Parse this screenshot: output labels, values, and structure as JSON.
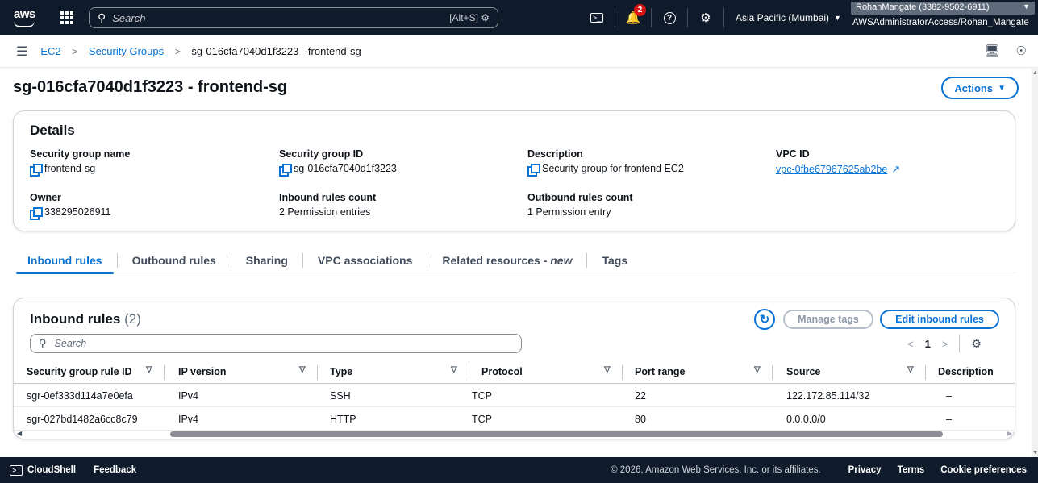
{
  "topnav": {
    "logo_text": "aws",
    "search_placeholder": "Search",
    "search_shortcut": "[Alt+S]",
    "notification_count": "2",
    "region": "Asia Pacific (Mumbai)",
    "account_name": "RohanMangate (3382-9502-6911)",
    "account_role": "AWSAdministratorAccess/Rohan_Mangate"
  },
  "breadcrumb": {
    "items": [
      "EC2",
      "Security Groups"
    ],
    "current": "sg-016cfa7040d1f3223 - frontend-sg"
  },
  "page": {
    "title": "sg-016cfa7040d1f3223 - frontend-sg",
    "actions_label": "Actions"
  },
  "details": {
    "heading": "Details",
    "fields": [
      {
        "label": "Security group name",
        "value": "frontend-sg"
      },
      {
        "label": "Security group ID",
        "value": "sg-016cfa7040d1f3223"
      },
      {
        "label": "Description",
        "value": "Security group for frontend EC2"
      },
      {
        "label": "VPC ID",
        "value": "vpc-0fbe67967625ab2be"
      },
      {
        "label": "Owner",
        "value": "338295026911"
      },
      {
        "label": "Inbound rules count",
        "value": "2 Permission entries"
      },
      {
        "label": "Outbound rules count",
        "value": "1 Permission entry"
      }
    ]
  },
  "tabs": {
    "inbound": "Inbound rules",
    "outbound": "Outbound rules",
    "sharing": "Sharing",
    "vpc": "VPC associations",
    "related": "Related resources - ",
    "related_new": "new",
    "tags": "Tags"
  },
  "rules": {
    "heading": "Inbound rules",
    "count": "(2)",
    "manage_tags": "Manage tags",
    "edit_rules": "Edit inbound rules",
    "search_placeholder": "Search",
    "page": "1",
    "columns": [
      "Security group rule ID",
      "IP version",
      "Type",
      "Protocol",
      "Port range",
      "Source",
      "Description"
    ],
    "rows": [
      [
        "sgr-0ef333d114a7e0efa",
        "IPv4",
        "SSH",
        "TCP",
        "22",
        "122.172.85.114/32",
        "–"
      ],
      [
        "sgr-027bd1482a6cc8c79",
        "IPv4",
        "HTTP",
        "TCP",
        "80",
        "0.0.0.0/0",
        "–"
      ]
    ]
  },
  "footer": {
    "cloudshell": "CloudShell",
    "feedback": "Feedback",
    "copyright": "© 2026, Amazon Web Services, Inc. or its affiliates.",
    "privacy": "Privacy",
    "terms": "Terms",
    "cookies": "Cookie preferences"
  },
  "colors": {
    "nav_bg": "#0f1b2a",
    "link_blue": "#0972d3",
    "badge_red": "#d91515"
  },
  "icons": {
    "search": "search-icon",
    "grid": "services-grid-icon",
    "cloudshell": "cloudshell-icon",
    "bell": "bell-icon",
    "help": "help-icon",
    "settings": "gear-icon",
    "copy": "copy-icon",
    "external": "external-link-icon",
    "refresh": "refresh-icon"
  }
}
